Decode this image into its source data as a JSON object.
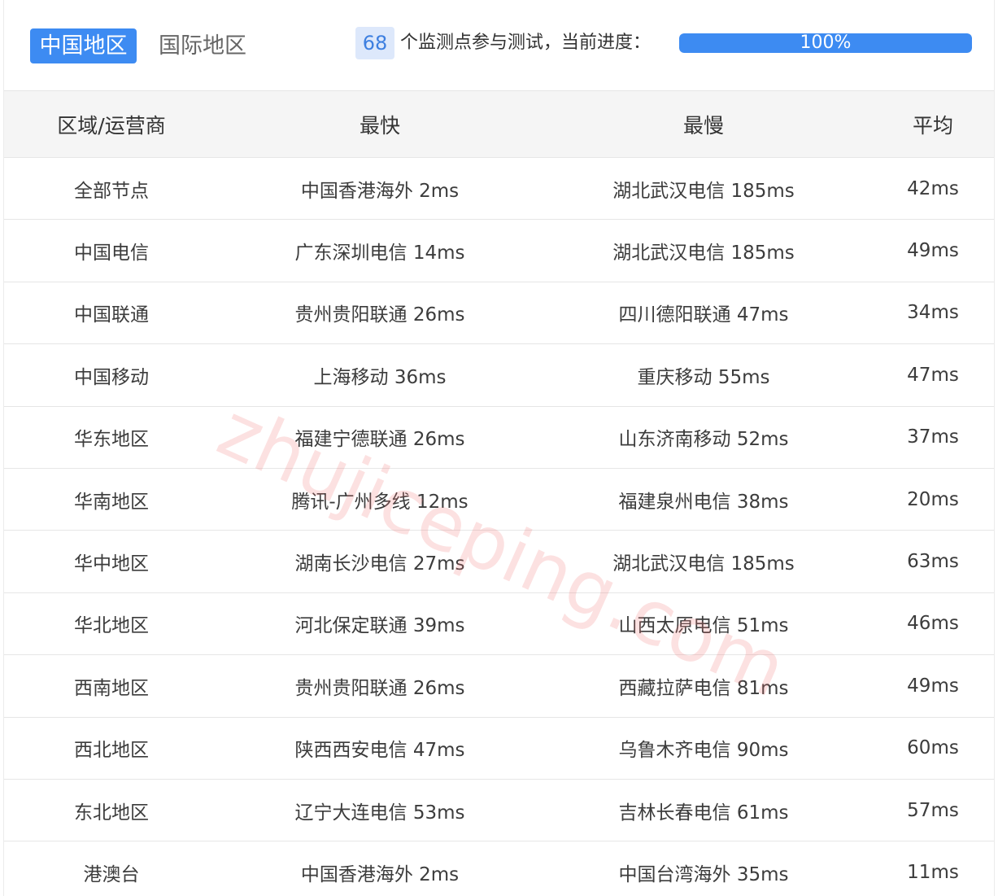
{
  "tabs": {
    "active": "中国地区",
    "inactive": "国际地区"
  },
  "monitor": {
    "count": "68",
    "text": "个监测点参与测试，当前进度：",
    "progress_label": "100%",
    "progress_value": 100,
    "accent_color": "#3d8bf2"
  },
  "table": {
    "headers": {
      "region": "区域/运营商",
      "fastest": "最快",
      "slowest": "最慢",
      "average": "平均"
    },
    "rows": [
      {
        "region": "全部节点",
        "fastest": "中国香港海外 2ms",
        "slowest": "湖北武汉电信 185ms",
        "average": "42ms"
      },
      {
        "region": "中国电信",
        "fastest": "广东深圳电信 14ms",
        "slowest": "湖北武汉电信 185ms",
        "average": "49ms"
      },
      {
        "region": "中国联通",
        "fastest": "贵州贵阳联通 26ms",
        "slowest": "四川德阳联通 47ms",
        "average": "34ms"
      },
      {
        "region": "中国移动",
        "fastest": "上海移动 36ms",
        "slowest": "重庆移动 55ms",
        "average": "47ms"
      },
      {
        "region": "华东地区",
        "fastest": "福建宁德联通 26ms",
        "slowest": "山东济南移动 52ms",
        "average": "37ms"
      },
      {
        "region": "华南地区",
        "fastest": "腾讯-广州多线 12ms",
        "slowest": "福建泉州电信 38ms",
        "average": "20ms"
      },
      {
        "region": "华中地区",
        "fastest": "湖南长沙电信 27ms",
        "slowest": "湖北武汉电信 185ms",
        "average": "63ms"
      },
      {
        "region": "华北地区",
        "fastest": "河北保定联通 39ms",
        "slowest": "山西太原电信 51ms",
        "average": "46ms"
      },
      {
        "region": "西南地区",
        "fastest": "贵州贵阳联通 26ms",
        "slowest": "西藏拉萨电信 81ms",
        "average": "49ms"
      },
      {
        "region": "西北地区",
        "fastest": "陕西西安电信 47ms",
        "slowest": "乌鲁木齐电信 90ms",
        "average": "60ms"
      },
      {
        "region": "东北地区",
        "fastest": "辽宁大连电信 53ms",
        "slowest": "吉林长春电信 61ms",
        "average": "57ms"
      },
      {
        "region": "港澳台",
        "fastest": "中国香港海外 2ms",
        "slowest": "中国台湾海外 35ms",
        "average": "11ms"
      }
    ]
  },
  "watermark": "zhujiceping.com"
}
